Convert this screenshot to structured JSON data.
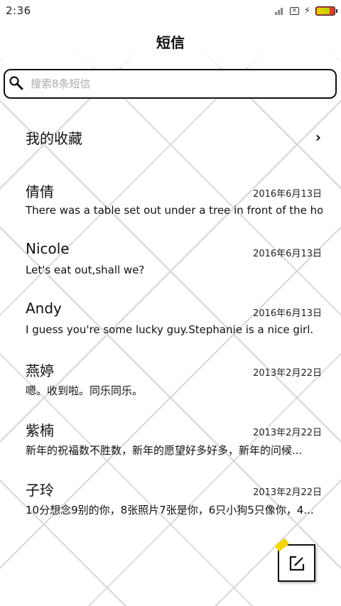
{
  "status_bar": {
    "time": "2:36",
    "icons": [
      "signal-icon",
      "sim-x-icon",
      "charging-bolt-icon",
      "battery-icon"
    ],
    "battery_level": 0.7
  },
  "header": {
    "title": "短信"
  },
  "search": {
    "placeholder": "搜索8条短信",
    "value": ""
  },
  "favorites": {
    "label": "我的收藏",
    "chevron": "›"
  },
  "messages": [
    {
      "name": "倩倩",
      "date": "2016年6月13日",
      "preview": "There was a table set out under a tree in front of the ho..."
    },
    {
      "name": "Nicole",
      "date": "2016年6月13日",
      "preview": "Let's eat out,shall we?"
    },
    {
      "name": "Andy",
      "date": "2016年6月13日",
      "preview": "I guess you're some lucky guy.Stephanie is a nice girl."
    },
    {
      "name": "燕婷",
      "date": "2013年2月22日",
      "preview": "嗯。收到啦。同乐同乐。"
    },
    {
      "name": "紫楠",
      "date": "2013年2月22日",
      "preview": "新年的祝福数不胜数，新年的愿望好多好多，新年的问候..."
    },
    {
      "name": "子玲",
      "date": "2013年2月22日",
      "preview": "10分想念9别的你，8张照片7张是你，6只小狗5只像你，4..."
    }
  ],
  "compose": {
    "icon": "compose-icon"
  },
  "colors": {
    "accent": "#f5d800",
    "text": "#111111",
    "grid": "#d8d8d8"
  }
}
